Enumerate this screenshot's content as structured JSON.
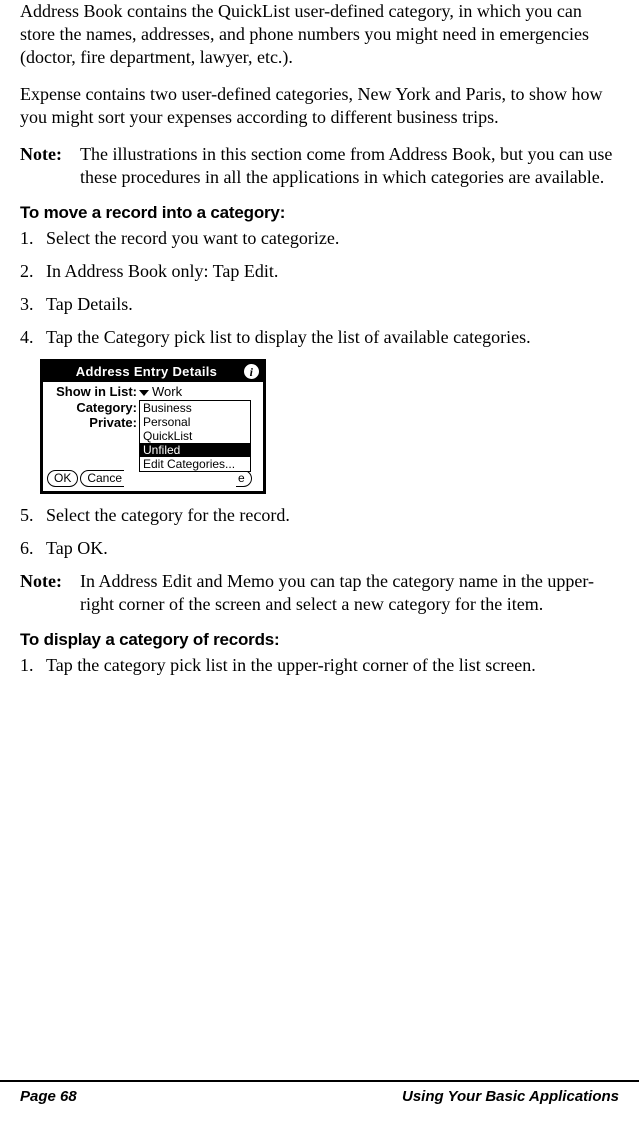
{
  "para1": "Address Book contains the QuickList user-defined category, in which you can store the names, addresses, and phone numbers you might need in emergencies (doctor, fire department, lawyer, etc.).",
  "para2": "Expense contains two user-defined categories, New York and Paris, to show how you might sort your expenses according to different business trips.",
  "note1": {
    "label": "Note:",
    "text": "The illustrations in this section come from Address Book, but you can use these procedures in all the applications in which categories are available."
  },
  "heading1": "To move a record into a category:",
  "steps1": [
    "Select the record you want to categorize.",
    "In Address Book only: Tap Edit.",
    "Tap Details.",
    "Tap the Category pick list to display the list of available categories."
  ],
  "palm": {
    "title": "Address Entry Details",
    "show_label": "Show in List:",
    "show_value": "Work",
    "category_label": "Category:",
    "private_label": "Private:",
    "menu": [
      "Business",
      "Personal",
      "QuickList",
      "Unfiled",
      "Edit Categories..."
    ],
    "selected_index": 3,
    "ok": "OK",
    "cancel": "Cance",
    "frag": "e"
  },
  "steps1b": [
    "Select the category for the record.",
    "Tap OK."
  ],
  "note2": {
    "label": "Note:",
    "text": "In Address Edit and Memo you can tap the category name in the upper-right corner of the screen and select a new category for the item."
  },
  "heading2": "To display a category of records:",
  "steps2": [
    "Tap the category pick list in the upper-right corner of the list screen."
  ],
  "footer": {
    "left": "Page 68",
    "right": "Using Your Basic Applications"
  }
}
